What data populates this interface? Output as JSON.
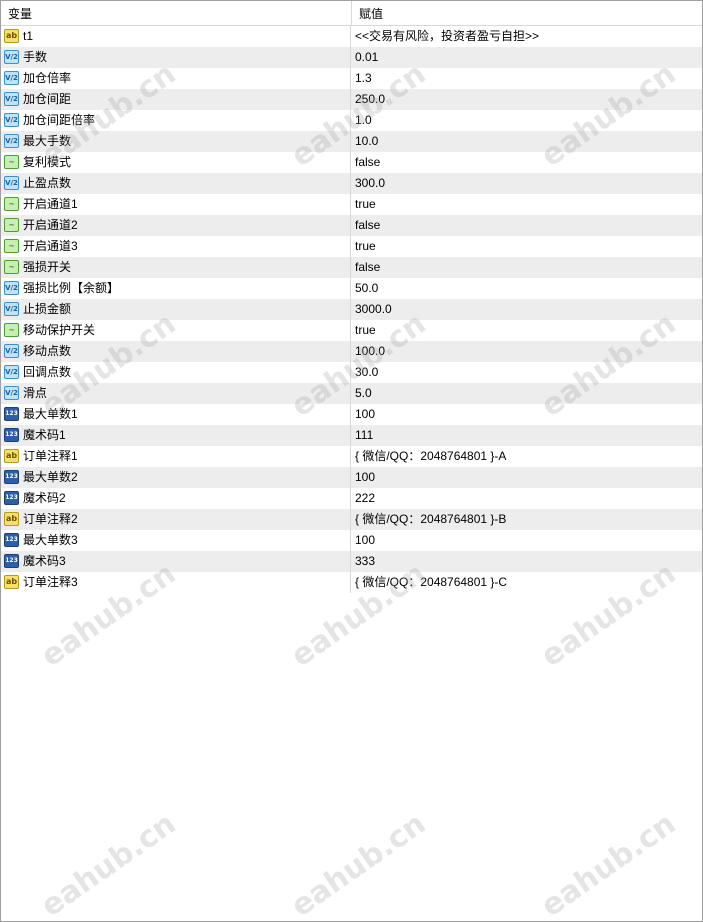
{
  "header": {
    "variable": "变量",
    "value": "赋值"
  },
  "rows": [
    {
      "icon": "ab",
      "name": "t1",
      "value": "<<交易有风险，投资者盈亏自担>>"
    },
    {
      "icon": "var",
      "name": "手数",
      "value": "0.01"
    },
    {
      "icon": "var",
      "name": "加仓倍率",
      "value": "1.3"
    },
    {
      "icon": "var",
      "name": "加仓间距",
      "value": "250.0"
    },
    {
      "icon": "var",
      "name": "加仓间距倍率",
      "value": "1.0"
    },
    {
      "icon": "var",
      "name": "最大手数",
      "value": "10.0"
    },
    {
      "icon": "bool",
      "name": "复利模式",
      "value": "false"
    },
    {
      "icon": "var",
      "name": "止盈点数",
      "value": "300.0"
    },
    {
      "icon": "bool",
      "name": "开启通道1",
      "value": "true"
    },
    {
      "icon": "bool",
      "name": "开启通道2",
      "value": "false"
    },
    {
      "icon": "bool",
      "name": "开启通道3",
      "value": "true"
    },
    {
      "icon": "bool",
      "name": "强损开关",
      "value": "false"
    },
    {
      "icon": "var",
      "name": "强损比例【余额】",
      "value": "50.0"
    },
    {
      "icon": "var",
      "name": "止损金额",
      "value": "3000.0"
    },
    {
      "icon": "bool",
      "name": "移动保护开关",
      "value": "true"
    },
    {
      "icon": "var",
      "name": "移动点数",
      "value": "100.0"
    },
    {
      "icon": "var",
      "name": "回调点数",
      "value": "30.0"
    },
    {
      "icon": "var",
      "name": "滑点",
      "value": "5.0"
    },
    {
      "icon": "int",
      "name": "最大单数1",
      "value": "100"
    },
    {
      "icon": "int",
      "name": "魔术码1",
      "value": "111"
    },
    {
      "icon": "ab",
      "name": "订单注释1",
      "value": "{ 微信/QQ：2048764801 }-A"
    },
    {
      "icon": "int",
      "name": "最大单数2",
      "value": "100"
    },
    {
      "icon": "int",
      "name": "魔术码2",
      "value": "222"
    },
    {
      "icon": "ab",
      "name": "订单注释2",
      "value": "{ 微信/QQ：2048764801 }-B"
    },
    {
      "icon": "int",
      "name": "最大单数3",
      "value": "100"
    },
    {
      "icon": "int",
      "name": "魔术码3",
      "value": "333"
    },
    {
      "icon": "ab",
      "name": "订单注释3",
      "value": "{ 微信/QQ：2048764801 }-C"
    }
  ],
  "icons": {
    "ab": "ab",
    "var": "V/2",
    "int": "123",
    "bool": "~"
  },
  "icon_names": {
    "ab": "string-type-icon",
    "var": "double-type-icon",
    "int": "integer-type-icon",
    "bool": "boolean-type-icon"
  },
  "watermark": "eahub.cn"
}
